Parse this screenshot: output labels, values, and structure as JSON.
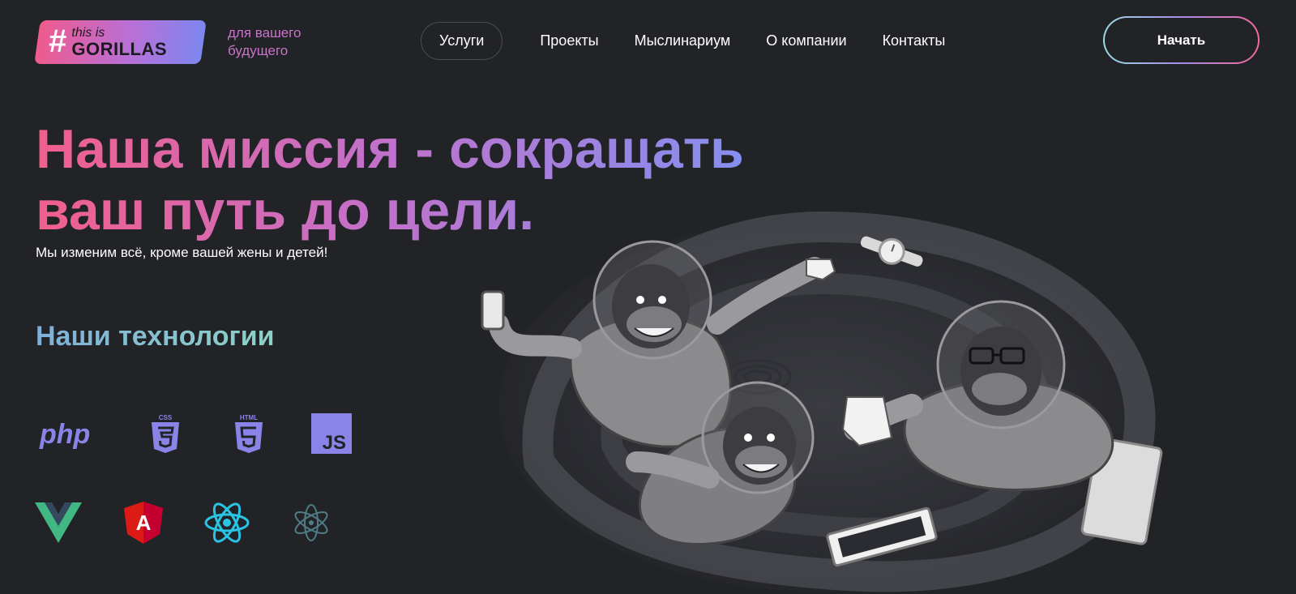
{
  "header": {
    "logo": {
      "hash": "#",
      "small": "this is",
      "big": "GORILLAS"
    },
    "tagline": "для вашего будущего",
    "nav": [
      {
        "label": "Услуги",
        "active": true
      },
      {
        "label": "Проекты"
      },
      {
        "label": "Мыслинариум"
      },
      {
        "label": "О компании"
      },
      {
        "label": "Контакты"
      }
    ],
    "start_label": "Начать"
  },
  "hero": {
    "title": "Наша миссия - сокращать ваш путь до цели.",
    "subtitle": "Мы изменим всё, кроме вашей жены и детей!"
  },
  "technologies": {
    "title": "Наши технологии",
    "icons": [
      "php-icon",
      "css3-icon",
      "html5-icon",
      "javascript-icon",
      "vue-icon",
      "angular-icon",
      "react-icon",
      "electron-icon"
    ],
    "php_text": "php",
    "css_text": "CSS",
    "html_text": "HTML",
    "js_text": "JS",
    "angular_text": "A"
  },
  "colors": {
    "background": "#222327",
    "accent_pink": "#f25f8c",
    "accent_violet": "#8191f2",
    "tech_purple": "#8a84e8",
    "vue_green": "#41b883",
    "angular_red": "#dd1b16",
    "react_cyan": "#29c3e3"
  }
}
